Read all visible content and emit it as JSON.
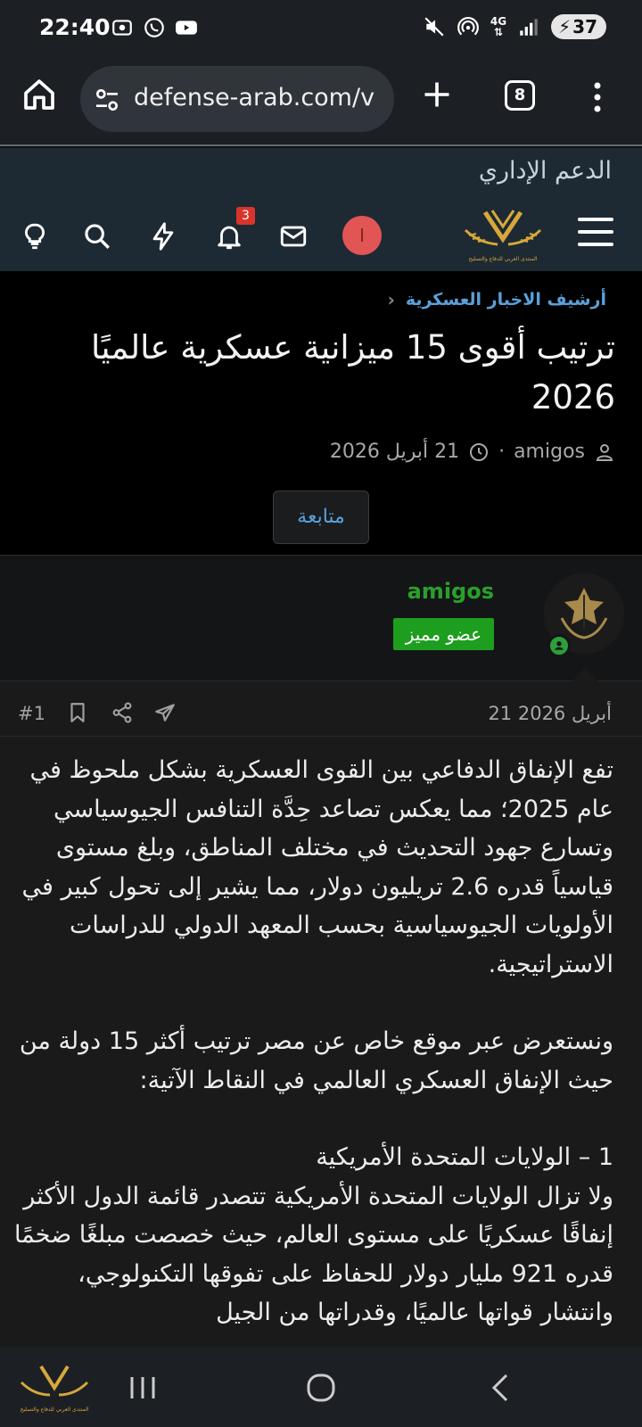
{
  "status_bar": {
    "time": "22:40",
    "network": "4G",
    "battery": "37",
    "icons_left": [
      "screenshot-icon",
      "whatsapp-icon",
      "youtube-icon"
    ],
    "icons_right": [
      "mute-icon",
      "hotspot-icon",
      "signal-icon",
      "battery-charging-icon"
    ]
  },
  "browser": {
    "url": "defense-arab.com/v",
    "tab_count": "8"
  },
  "site_header": {
    "admin_support": "الدعم الإداري",
    "notification_count": "3",
    "avatar_letter": "ا",
    "logo_text": "المنتدى العربي للدفاع والتسليح"
  },
  "thread": {
    "breadcrumb": "أرشيف الاخبار العسكرية",
    "title": "ترتيب أقوى 15 ميزانية عسكرية عالميًا 2026",
    "author": "amigos",
    "date": "21 أبريل 2026",
    "separator": "·",
    "follow_label": "متابعة"
  },
  "post": {
    "username": "amigos",
    "role": "عضو مميز",
    "date": "21 أبريل 2026",
    "number": "#1",
    "paragraphs": [
      "تفع الإنفاق الدفاعي بين القوى العسكرية بشكل ملحوظ في عام 2025؛ مما يعكس تصاعد حِدَّة التنافس الجيوسياسي وتسارع جهود التحديث في مختلف المناطق، وبلغ مستوى قياسياً قدره 2.6 تريليون دولار، مما يشير إلى تحول كبير في الأولويات الجيوسياسية بحسب المعهد الدولي للدراسات الاستراتيجية.",
      "ونستعرض عبر موقع خاص عن مصر ترتيب أكثر 15 دولة من حيث الإنفاق العسكري العالمي في النقاط الآتية:",
      "1 – الولايات المتحدة الأمريكية",
      "ولا تزال الولايات المتحدة الأمريكية تتصدر قائمة الدول الأكثر إنفاقًا عسكريًا على مستوى العالم، حيث خصصت مبلغًا ضخمًا قدره 921 مليار دولار للحفاظ على تفوقها التكنولوجي، وانتشار قواتها عالميًا، وقدراتها من الجيل"
    ]
  },
  "colors": {
    "link_blue": "#5aa0db",
    "username_green": "#2aa02a",
    "badge_green": "#1e9e1e",
    "header_bg": "#1e2a33",
    "notif_red": "#d9342b"
  }
}
